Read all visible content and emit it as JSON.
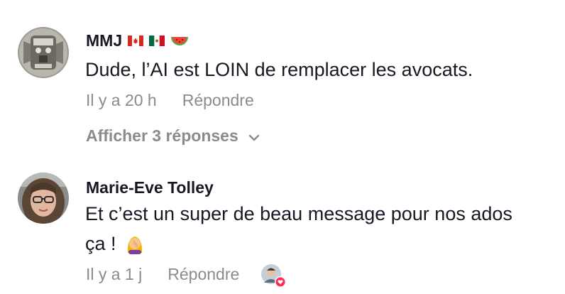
{
  "comments": [
    {
      "author": "MMJ",
      "author_emojis": [
        "canada-flag-icon",
        "mexico-flag-icon",
        "watermelon-icon"
      ],
      "text": "Dude, l’AI est LOIN de remplacer les avocats.",
      "time": "Il y a 20 h",
      "reply_label": "Répondre",
      "show_replies_label": "Afficher 3 réponses"
    },
    {
      "author": "Marie-Eve Tolley",
      "text_line1": "Et c’est un super de beau message pour nos ados",
      "text_line2": "ça !",
      "text_emoji": "facepalm-woman-icon",
      "time": "Il y a 1 j",
      "reply_label": "Répondre",
      "liked_by_creator_icon": "heart-icon"
    }
  ],
  "colors": {
    "text": "#161823",
    "muted": "#8a8b91",
    "heart": "#fe2c55"
  }
}
